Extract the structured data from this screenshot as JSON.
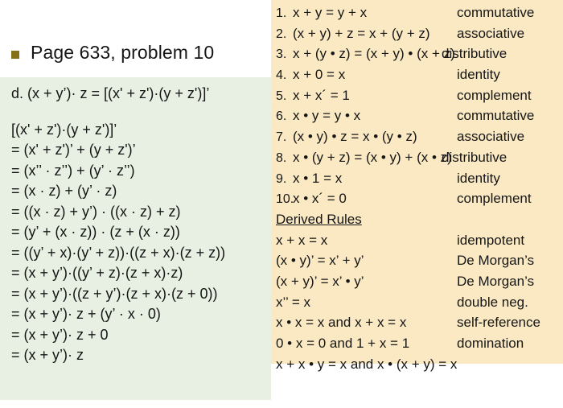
{
  "slide": {
    "title": "Page 633, problem 10",
    "bullet_color": "#87701a"
  },
  "work_panel": {
    "background_color": "#e7f0e3",
    "statement": "d. (x + y’)· z = [(x' + z')·(y + z')]’",
    "lines": [
      "[(x' + z')·(y + z')]’",
      "= (x' + z')’ + (y + z')’",
      "= (x’’ · z’’) + (y’ · z’’)",
      "= (x · z) + (y’ · z)",
      "= ((x · z) + y’) · ((x · z) + z)",
      "= (y’ + (x · z)) · (z + (x · z))",
      "= ((y’ + x)·(y’ + z))·((z + x)·(z + z))",
      "= (x + y’)·((y’ + z)·(z + x)·z)",
      "= (x + y’)·((z + y’)·(z + x)·(z + 0))",
      "= (x + y’)· z + (y’ · x · 0)",
      "= (x + y’)· z + 0",
      "= (x + y’)· z"
    ]
  },
  "rules_panel": {
    "background_color": "#fae9c2",
    "axioms": [
      {
        "num": "1.",
        "expr": "x + y = y + x",
        "name": "commutative"
      },
      {
        "num": "2.",
        "expr": "(x + y) + z = x + (y + z)",
        "name": "associative"
      },
      {
        "num": "3.",
        "expr": "x + (y • z) = (x + y) • (x + z)",
        "name": "distributive"
      },
      {
        "num": "4.",
        "expr": "x + 0 = x",
        "name": "identity"
      },
      {
        "num": "5.",
        "expr": "x + x´ = 1",
        "name": "complement"
      },
      {
        "num": "6.",
        "expr": "x • y = y • x",
        "name": "commutative"
      },
      {
        "num": "7.",
        "expr": "(x • y) • z = x • (y • z)",
        "name": "associative"
      },
      {
        "num": "8.",
        "expr": "x • (y + z) = (x • y) + (x • z)",
        "name": "distributive"
      },
      {
        "num": "9.",
        "expr": "x • 1 = x",
        "name": "identity"
      },
      {
        "num": "10.",
        "expr": "x • x´ = 0",
        "name": "complement"
      }
    ],
    "derived_heading": "Derived Rules",
    "derived": [
      {
        "expr": "x + x = x",
        "name": "idempotent"
      },
      {
        "expr": "(x • y)’ = x’ + y’",
        "name": "De Morgan’s"
      },
      {
        "expr": "(x + y)’ = x’ • y’",
        "name": "De Morgan’s"
      },
      {
        "expr": "x’’ = x",
        "name": "double neg."
      },
      {
        "expr": "x • x = x and x + x = x",
        "name": "self-reference"
      },
      {
        "expr": "0 • x = 0 and 1 + x = 1",
        "name": "domination"
      },
      {
        "expr": "x + x • y = x and x • (x + y) = x",
        "name": ""
      }
    ]
  }
}
